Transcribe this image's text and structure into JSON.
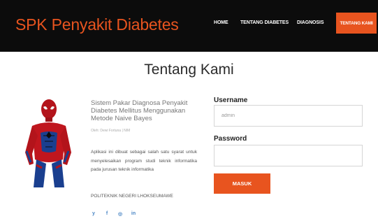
{
  "nav": {
    "brand": "SPK Penyakit Diabetes",
    "items": [
      {
        "label": "HOME"
      },
      {
        "label": "TENTANG DIABETES"
      },
      {
        "label": "DIAGNOSIS"
      },
      {
        "label": "TENTANG KAMI",
        "active": true
      }
    ],
    "accent_color": "#e8541f",
    "bar_color": "#0c0c0c"
  },
  "main": {
    "title": "Tentang Kami",
    "tagline": "Sistem Pakar Diagnosa Penyakit Diabetes Mellitus Menggunakan Metode Naive Bayes",
    "author": "Oleh: Dewi Fortuna | NIM",
    "description": "Aplikasi ini dibuat sebagai salah satu syarat untuk menyelesaikan program studi teknik informatika pada jurusan teknik informatika",
    "institution": "POLITEKNIK NEGERI LHOKSEUMAWE",
    "social": [
      {
        "icon": "twitter-icon",
        "glyph": "y"
      },
      {
        "icon": "facebook-icon",
        "glyph": "f"
      },
      {
        "icon": "dribbble-icon",
        "glyph": "◎"
      },
      {
        "icon": "linkedin-icon",
        "glyph": "in"
      }
    ]
  },
  "login": {
    "username_label": "Username",
    "username_value": "admin",
    "password_label": "Password",
    "password_value": "",
    "submit_label": "MASUK"
  }
}
